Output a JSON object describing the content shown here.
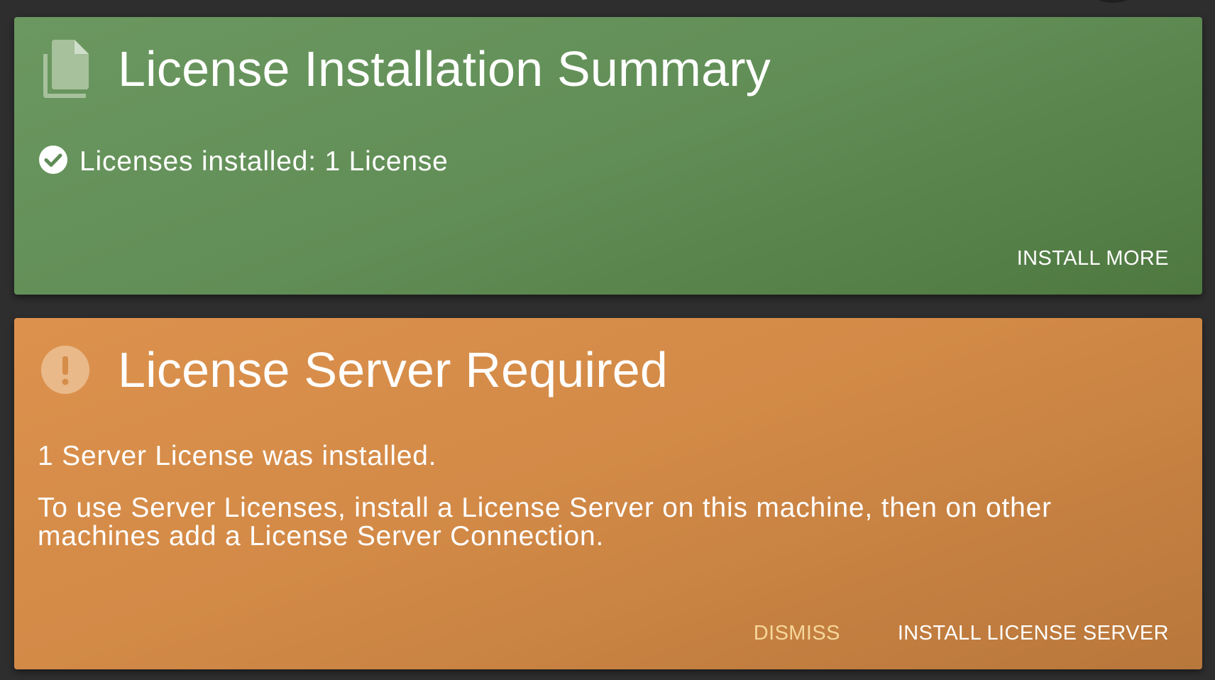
{
  "summary_card": {
    "title": "License Installation Summary",
    "icon": "file-copy-icon",
    "status_icon": "check-circle-icon",
    "status_text": "Licenses installed: 1 License",
    "install_more_label": "INSTALL MORE",
    "color": "#649255"
  },
  "server_card": {
    "title": "License Server Required",
    "icon": "exclamation-circle-icon",
    "message_line_1": "1 Server License was installed.",
    "message_line_2": "To use Server Licenses, install a License Server on this machine, then on other machines add a License Server Connection.",
    "dismiss_label": "DISMISS",
    "install_server_label": "INSTALL LICENSE SERVER",
    "color": "#d68d49",
    "dismiss_color": "#f7d79b"
  }
}
